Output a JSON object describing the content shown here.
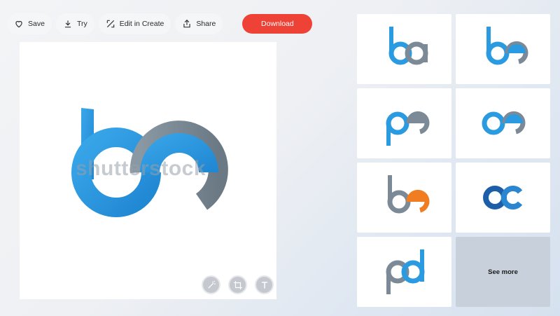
{
  "toolbar": {
    "save_label": "Save",
    "try_label": "Try",
    "edit_label": "Edit in Create",
    "share_label": "Share",
    "download_label": "Download",
    "download_color": "#ef4236"
  },
  "main_image": {
    "logo_letters": "be",
    "watermark": "shutterstock",
    "tools": [
      {
        "icon": "magic-wand-icon"
      },
      {
        "icon": "crop-icon"
      },
      {
        "icon": "text-icon"
      }
    ]
  },
  "related": {
    "items": [
      {
        "letters": "ba",
        "colors": [
          "#2a9be0",
          "#7b8a96"
        ]
      },
      {
        "letters": "be",
        "colors": [
          "#2a9be0",
          "#7b8a96"
        ]
      },
      {
        "letters": "pe",
        "colors": [
          "#2a9be0",
          "#7b8a96"
        ]
      },
      {
        "letters": "oe",
        "colors": [
          "#2a9be0",
          "#7b8a96"
        ]
      },
      {
        "letters": "be",
        "colors": [
          "#7b8a96",
          "#f07d22"
        ]
      },
      {
        "letters": "oc",
        "colors": [
          "#1c5fa8",
          "#2a86d0"
        ]
      },
      {
        "letters": "pd",
        "colors": [
          "#7b8a96",
          "#2a9be0"
        ]
      }
    ],
    "see_more_label": "See more"
  },
  "colors": {
    "brand_blue": "#2a9be0",
    "gray": "#7b8a96",
    "orange": "#f07d22",
    "navy": "#1c5fa8"
  }
}
